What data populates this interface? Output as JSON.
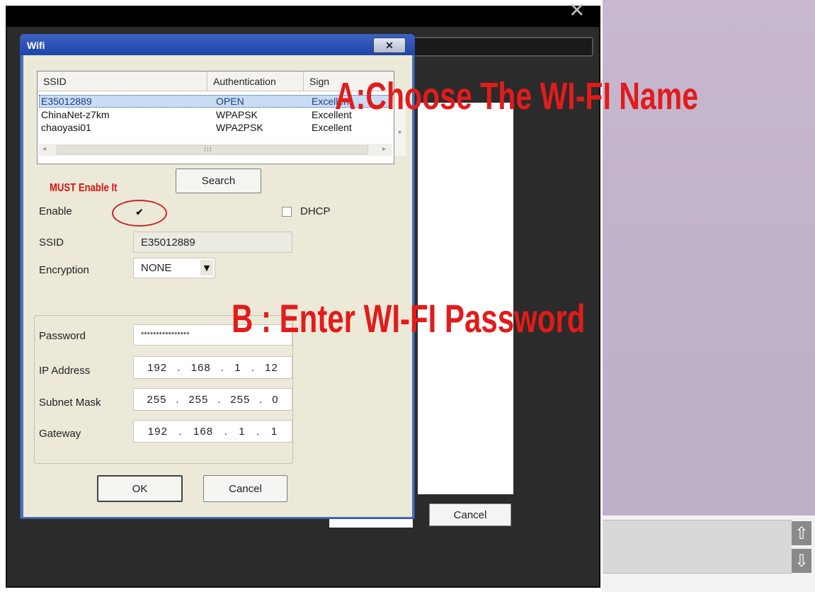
{
  "window": {
    "close_glyph": "✕"
  },
  "dialog": {
    "title": "Wifi",
    "close_glyph": "✕"
  },
  "list": {
    "headers": [
      "SSID",
      "Authentication",
      "Sign"
    ],
    "rows": [
      {
        "ssid": "E35012889",
        "auth": "OPEN",
        "signal": "Excellent",
        "selected": true
      },
      {
        "ssid": "ChinaNet-z7km",
        "auth": "WPAPSK",
        "signal": "Excellent",
        "selected": false
      },
      {
        "ssid": "chaoyasi01",
        "auth": "WPA2PSK",
        "signal": "Excellent",
        "selected": false
      }
    ],
    "scroll_mark": "III"
  },
  "search_button": "Search",
  "must_enable_note": "MUST Enable It",
  "enable": {
    "label": "Enable",
    "checked": true,
    "check_glyph": "✔"
  },
  "dhcp": {
    "label": "DHCP",
    "checked": false
  },
  "ssid_field": {
    "label": "SSID",
    "value": "E35012889"
  },
  "encryption": {
    "label": "Encryption",
    "value": "NONE"
  },
  "password": {
    "label": "Password",
    "value": "****************"
  },
  "ip_address": {
    "label": "IP Address",
    "octets": [
      "192",
      "168",
      "1",
      "12"
    ]
  },
  "subnet_mask": {
    "label": "Subnet Mask",
    "octets": [
      "255",
      "255",
      "255",
      "0"
    ]
  },
  "gateway": {
    "label": "Gateway",
    "octets": [
      "192",
      "168",
      "1",
      "1"
    ]
  },
  "ok_button": "OK",
  "cancel_button": "Cancel",
  "background_cancel_button": "Cancel",
  "annotations": {
    "a": "A:Choose The WI-FI Name",
    "b": "B : Enter WI-FI Password"
  },
  "colors": {
    "annotation": "#e21b1b",
    "title_bar": "#1f46a8",
    "dialog_body": "#ece9d8"
  }
}
